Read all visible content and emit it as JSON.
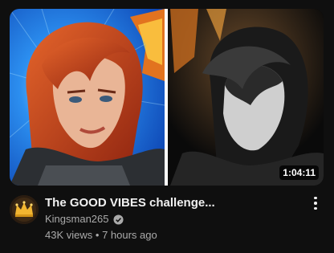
{
  "video": {
    "duration": "1:04:11",
    "title": "The GOOD VIBES challenge...",
    "channel": "Kingsman265",
    "views": "43K views",
    "separator": "•",
    "age": "7 hours ago"
  },
  "icons": {
    "verified": "verified-check-icon",
    "more": "more-vertical-icon",
    "avatar": "crown-avatar"
  },
  "colors": {
    "background": "#0f0f0f",
    "title": "#f1f1f1",
    "secondary_text": "#aaaaaa",
    "thumb_left_bg": "#1f7fe0",
    "hair": "#c1441c"
  }
}
